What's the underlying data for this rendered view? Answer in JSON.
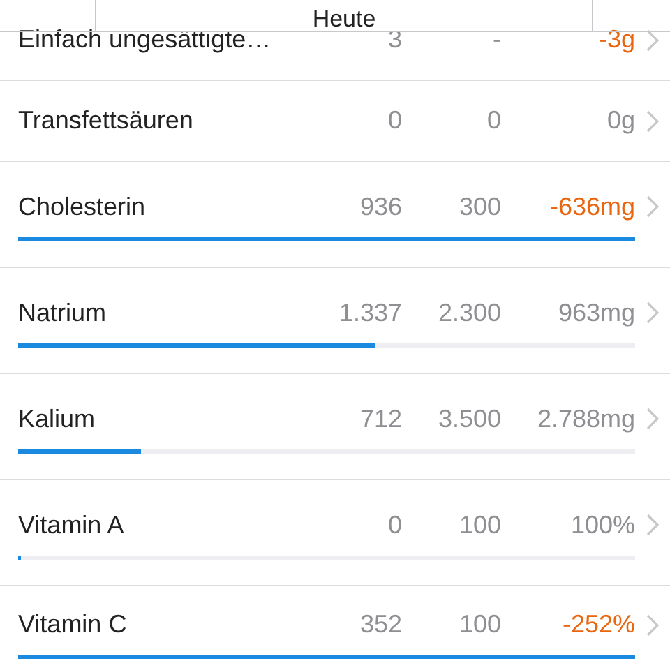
{
  "header": {
    "title": "Heute"
  },
  "rows": [
    {
      "kind": "plain",
      "name": "Einfach ungesättigte…",
      "value": "3",
      "goal": "-",
      "remaining": "-3g",
      "over": true
    },
    {
      "kind": "plain",
      "name": "Transfettsäuren",
      "value": "0",
      "goal": "0",
      "remaining": "0g",
      "over": false
    },
    {
      "kind": "bar",
      "name": "Cholesterin",
      "value": "936",
      "goal": "300",
      "remaining": "-636mg",
      "over": true,
      "level": 1
    },
    {
      "kind": "bar",
      "name": "Natrium",
      "value": "1.337",
      "goal": "2.300",
      "remaining": "963mg",
      "over": false,
      "level": 0.58
    },
    {
      "kind": "bar",
      "name": "Kalium",
      "value": "712",
      "goal": "3.500",
      "remaining": "2.788mg",
      "over": false,
      "level": 0.2
    },
    {
      "kind": "bar",
      "name": "Vitamin A",
      "value": "0",
      "goal": "100",
      "remaining": "100%",
      "over": false,
      "level": 0.005
    },
    {
      "kind": "bar",
      "name": "Vitamin C",
      "value": "352",
      "goal": "100",
      "remaining": "-252%",
      "over": true,
      "level": 1
    }
  ]
}
